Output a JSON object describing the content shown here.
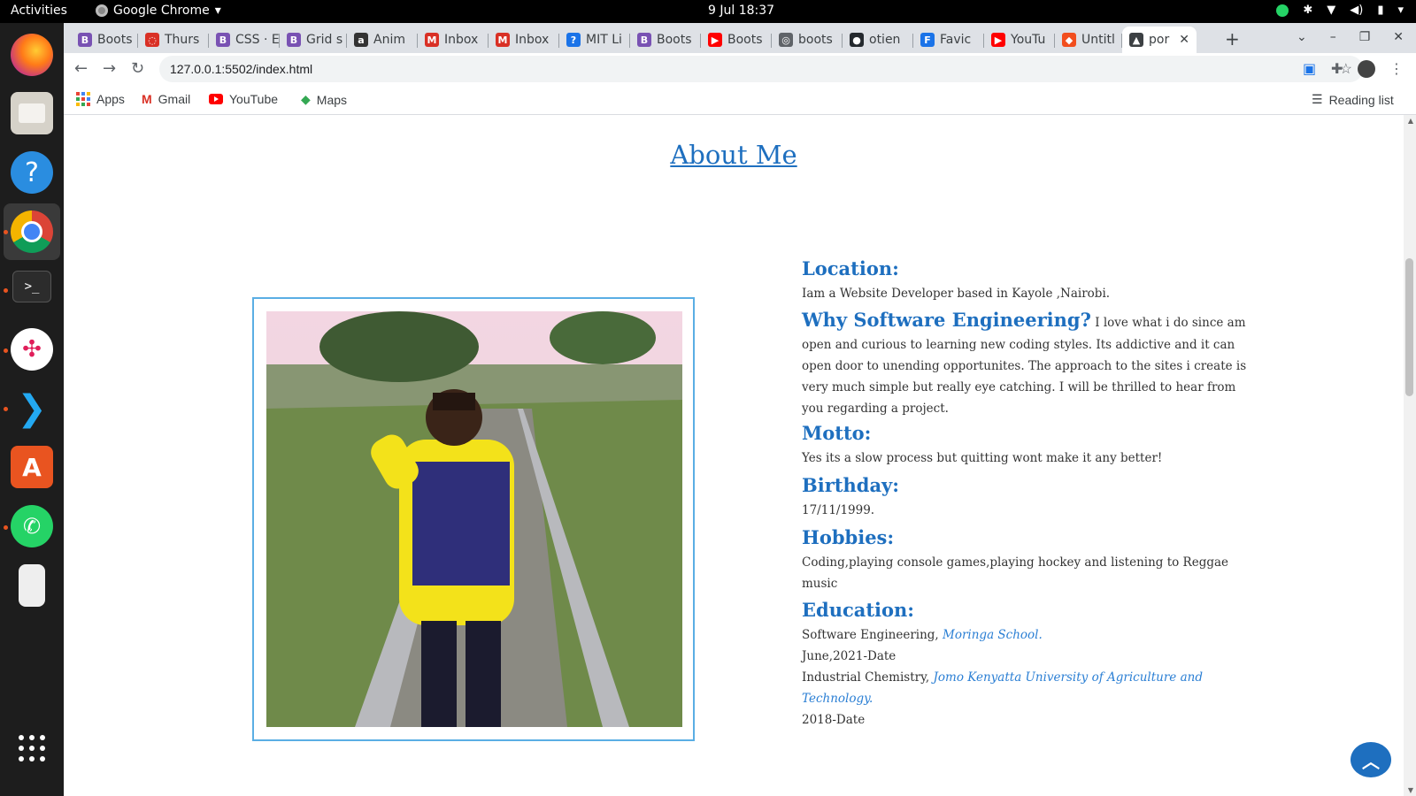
{
  "topbar": {
    "activities": "Activities",
    "app_menu": "Google Chrome",
    "clock": "9 Jul  18:37"
  },
  "dock": {
    "apps": [
      "firefox",
      "files",
      "help",
      "chrome",
      "terminal",
      "slack",
      "vscode",
      "software-center",
      "whatsapp",
      "ipod",
      "show-apps"
    ]
  },
  "tabs": [
    {
      "label": "Boots",
      "icon": "bootstrap-icon",
      "color": "#7952b3"
    },
    {
      "label": "Thurs",
      "icon": "scrum-icon",
      "color": "#d93025"
    },
    {
      "label": "CSS · E",
      "icon": "bootstrap-icon",
      "color": "#7952b3"
    },
    {
      "label": "Grid s",
      "icon": "bootstrap-icon",
      "color": "#7952b3"
    },
    {
      "label": "Anim",
      "icon": "animate-icon",
      "color": "#333333"
    },
    {
      "label": "Inbox",
      "icon": "gmail-icon",
      "color": "#d93025"
    },
    {
      "label": "Inbox",
      "icon": "gmail-icon",
      "color": "#d93025"
    },
    {
      "label": "MIT Li",
      "icon": "mit-icon",
      "color": "#1a73e8"
    },
    {
      "label": "Boots",
      "icon": "bootstrap-icon",
      "color": "#7952b3"
    },
    {
      "label": "Boots",
      "icon": "youtube-icon",
      "color": "#ff0000"
    },
    {
      "label": "boots",
      "icon": "globe-icon",
      "color": "#5f6368"
    },
    {
      "label": "otien",
      "icon": "github-icon",
      "color": "#24292e"
    },
    {
      "label": "Favic",
      "icon": "favicon-icon",
      "color": "#1a73e8"
    },
    {
      "label": "YouTu",
      "icon": "youtube-icon",
      "color": "#ff0000"
    },
    {
      "label": "Untitl",
      "icon": "figma-icon",
      "color": "#f24e1e"
    },
    {
      "label": "por",
      "icon": "portfolio-icon",
      "color": "#3c4043",
      "active": true
    }
  ],
  "toolbar": {
    "url": "127.0.0.1:5502/index.html"
  },
  "bookmarks": {
    "apps": "Apps",
    "gmail": "Gmail",
    "youtube": "YouTube",
    "maps": "Maps",
    "reading_list": "Reading list"
  },
  "page": {
    "title": "About Me",
    "location_heading": "Location:",
    "location_text": "Iam a Website Developer based in Kayole ,Nairobi.",
    "why_heading": "Why Software Engineering?",
    "why_text": " I love what i do since am open and curious to learning new coding styles. Its addictive and it can open door to unending opportunites. The approach to the sites i create is very much simple but really eye catching. I will be thrilled to hear from you regarding a project.",
    "motto_heading": "Motto:",
    "motto_text": "Yes its a slow process but quitting wont make it any better!",
    "birthday_heading": "Birthday:",
    "birthday_text": "17/11/1999.",
    "hobbies_heading": "Hobbies:",
    "hobbies_text": "Coding,playing console games,playing hockey and listening to Reggae music",
    "education_heading": "Education:",
    "edu1_course": "Software Engineering, ",
    "edu1_school": "Moringa School.",
    "edu1_dates": "June,2021-Date",
    "edu2_course": "Industrial Chemistry, ",
    "edu2_school": "Jomo Kenyatta University of Agriculture and Technology.",
    "edu2_dates": "2018-Date",
    "accent_color": "#1e6fbf"
  }
}
